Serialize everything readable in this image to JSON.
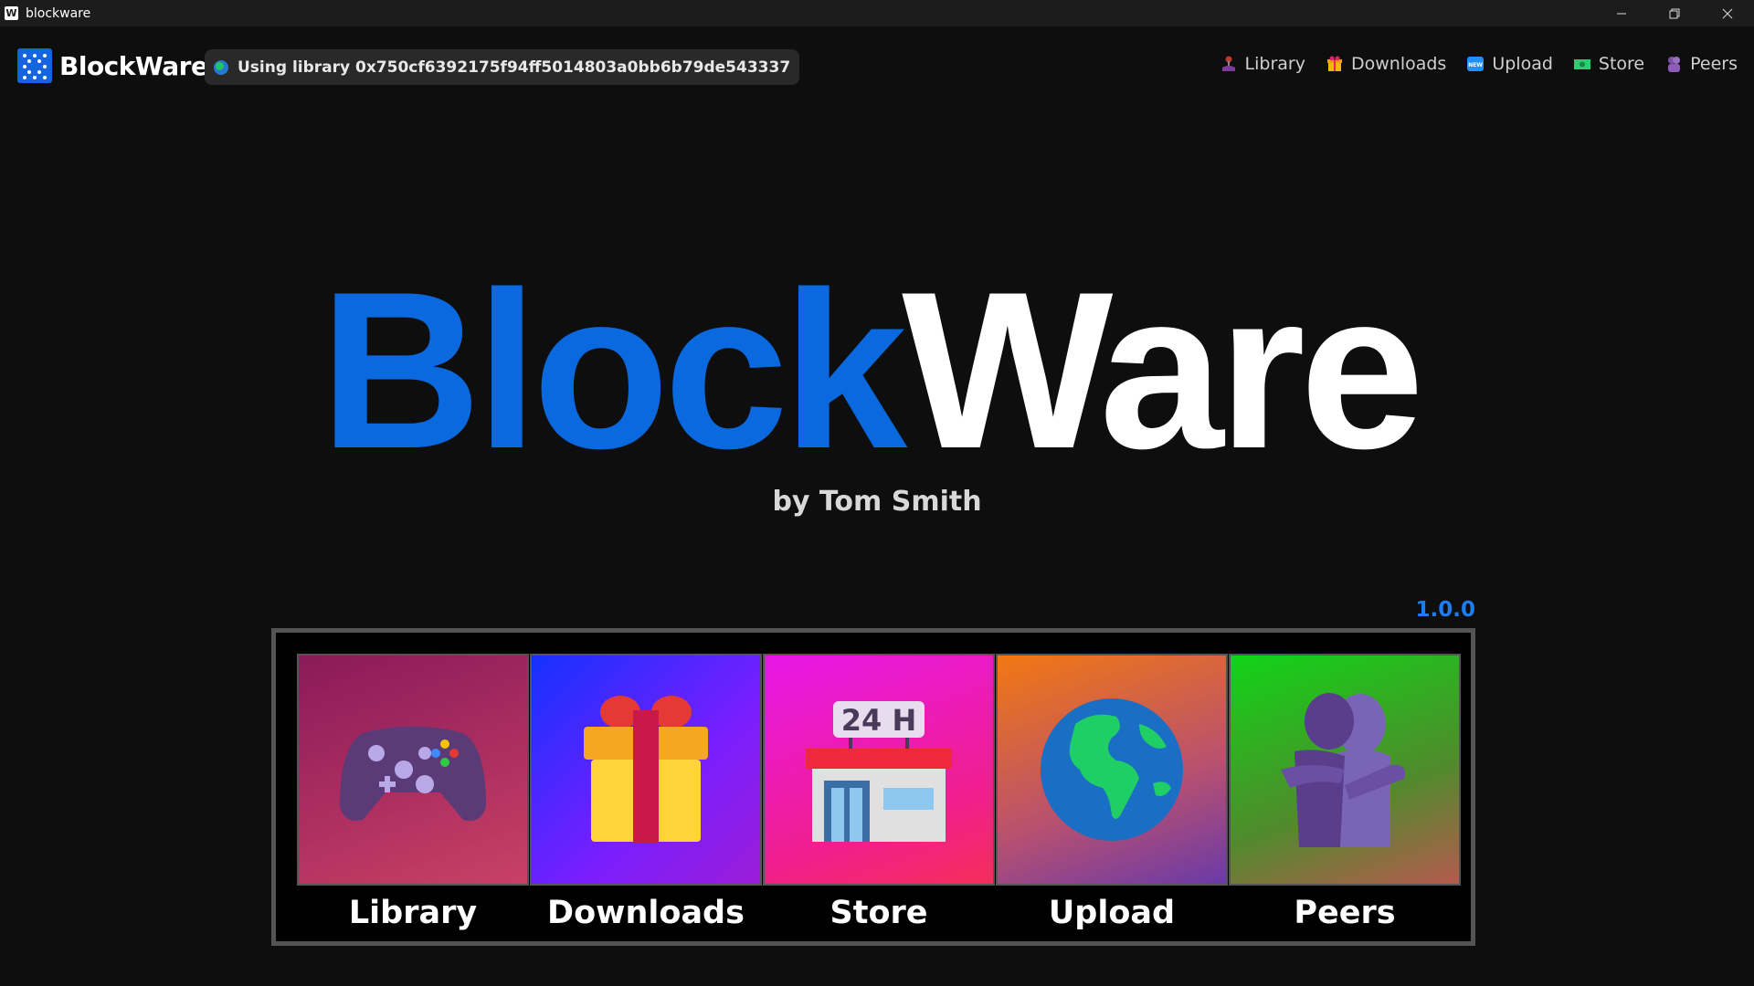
{
  "window": {
    "title": "blockware",
    "app_icon": "W",
    "controls": {
      "minimize": "—",
      "restore": "❐",
      "close": "✕"
    }
  },
  "header": {
    "brand_name": "BlockWare",
    "library_text": "Using library 0x750cf6392175f94ff5014803a0bb6b79de543337",
    "nav": [
      {
        "label": "Library",
        "icon": "joystick-icon",
        "color": "#9b59b6"
      },
      {
        "label": "Downloads",
        "icon": "gift-icon",
        "color": "#e74c3c"
      },
      {
        "label": "Upload",
        "icon": "new-badge-icon",
        "color": "#3498db"
      },
      {
        "label": "Store",
        "icon": "money-icon",
        "color": "#27ae60"
      },
      {
        "label": "Peers",
        "icon": "hug-icon",
        "color": "#8e44ad"
      }
    ]
  },
  "hero": {
    "logo_blue": "Block",
    "logo_white": "Ware",
    "byline": "by Tom Smith",
    "version": "1.0.0"
  },
  "tiles": [
    {
      "label": "Library",
      "icon": "game-controller-icon"
    },
    {
      "label": "Downloads",
      "icon": "gift-box-icon"
    },
    {
      "label": "Store",
      "icon": "store-24h-icon",
      "sign": "24 H"
    },
    {
      "label": "Upload",
      "icon": "globe-icon"
    },
    {
      "label": "Peers",
      "icon": "people-hugging-icon"
    }
  ],
  "colors": {
    "accent": "#0b69e0",
    "version": "#1e7cf0",
    "background": "#0f0e0f"
  }
}
